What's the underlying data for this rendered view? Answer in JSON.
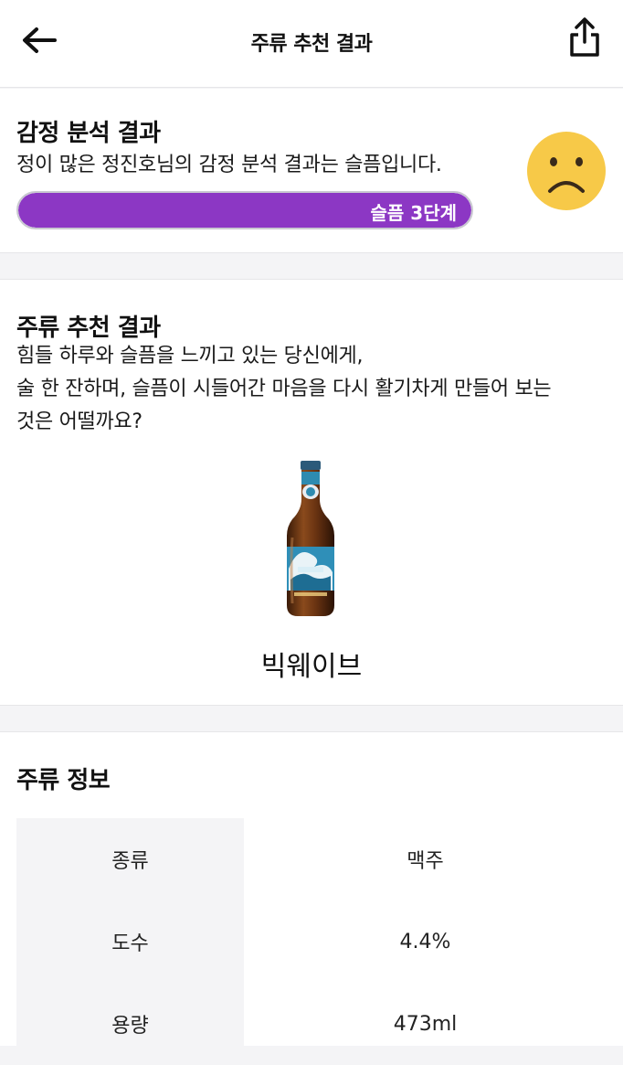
{
  "header": {
    "title": "주류 추천 결과",
    "back_icon": "arrow-left-icon",
    "share_icon": "share-icon"
  },
  "emotion": {
    "title": "감정 분석 결과",
    "description": "정이 많은 정진호님의 감정 분석 결과는 슬픔입니다.",
    "level_label": "슬픔 3단계",
    "level_value": 1.0,
    "emoji_icon": "sad-face-icon",
    "accent_color": "#8C37C4",
    "emoji_color": "#F7C948"
  },
  "recommendation": {
    "title": "주류 추천 결과",
    "lines": [
      "힘들 하루와 슬픔을 느끼고 있는 당신에게,",
      "술 한 잔하며, 슬픔이 시들어간 마음을 다시 활기차게 만들어 보는",
      "것은 어떨까요?"
    ],
    "drink_name": "빅웨이브",
    "drink_image_icon": "beer-bottle-icon"
  },
  "info": {
    "title": "주류 정보",
    "rows": [
      {
        "key": "종류",
        "value": "맥주"
      },
      {
        "key": "도수",
        "value": "4.4%"
      },
      {
        "key": "용량",
        "value": "473ml"
      }
    ]
  }
}
